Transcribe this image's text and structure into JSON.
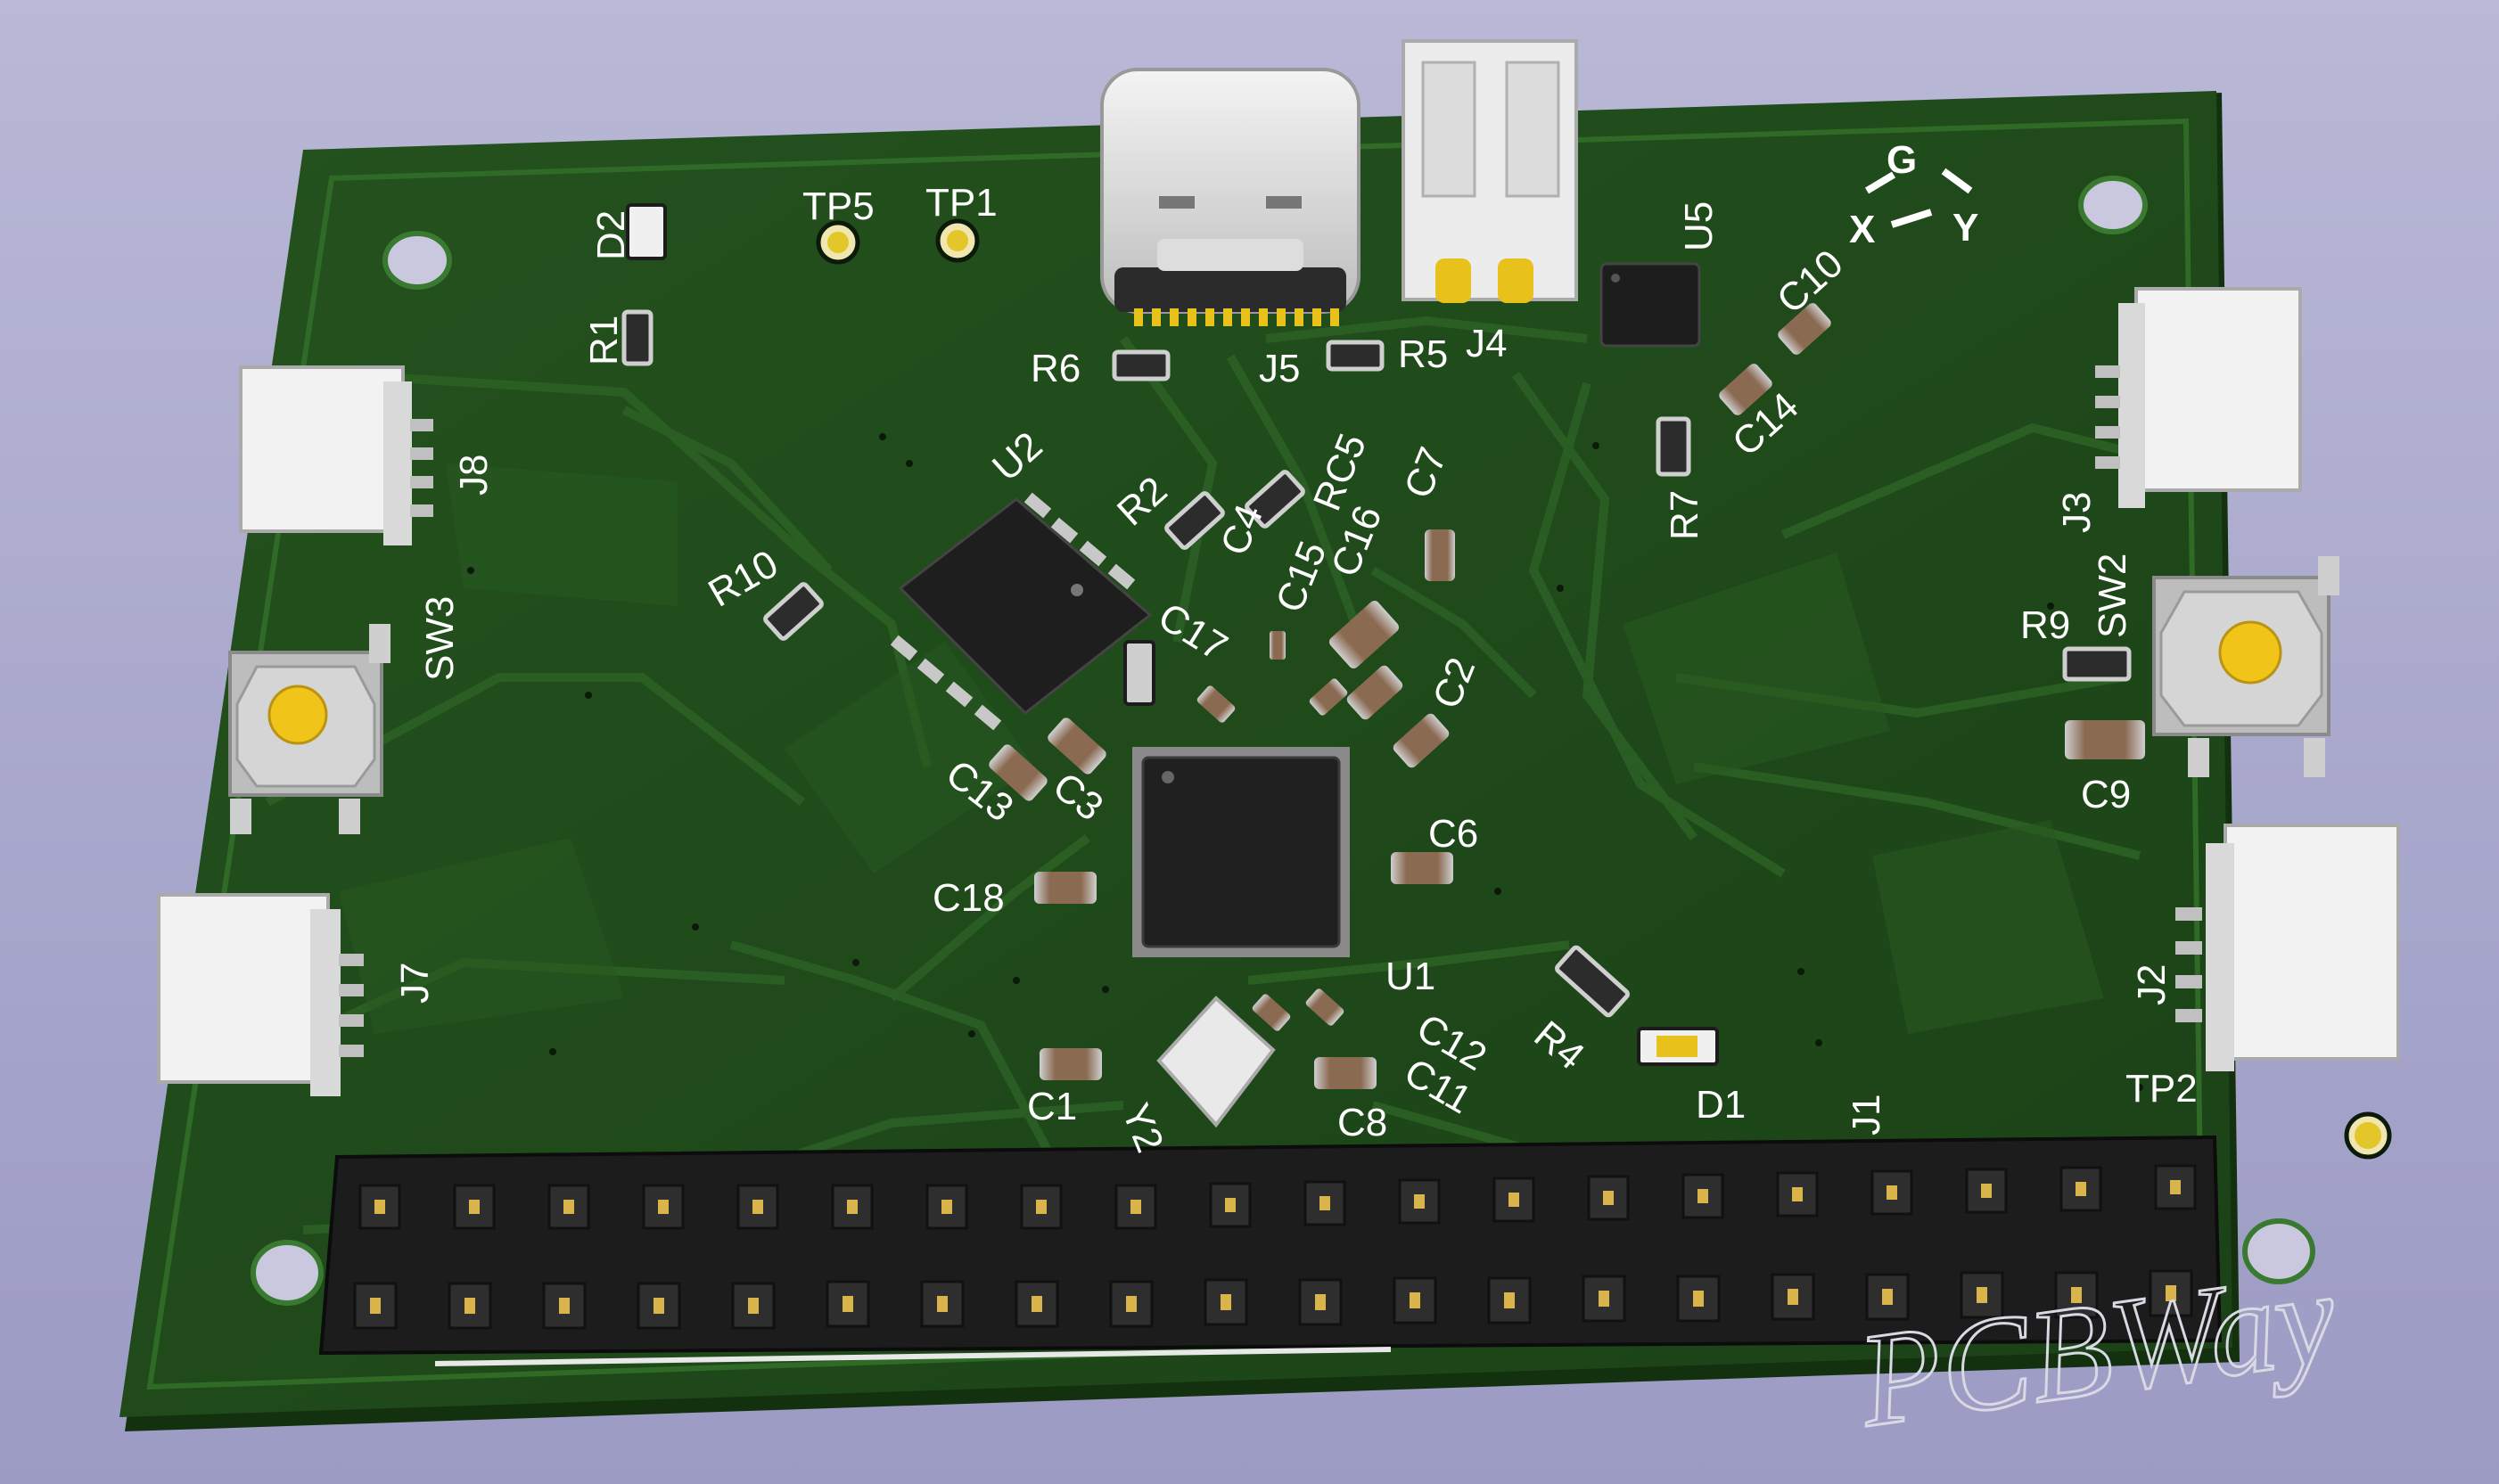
{
  "board": {
    "colors": {
      "solder_mask": "#1f4a1a",
      "copper_pour": "#2b5e23",
      "silkscreen": "#ffffff",
      "pad_gold": "#e8c21a",
      "connector_white": "#f2f2f2",
      "header_black": "#1c1c1c",
      "background": "#a8a7cc"
    },
    "orientation_mark": {
      "g": "G",
      "x": "X",
      "y": "Y"
    },
    "watermark": "PCBWay",
    "labels": {
      "d2": "D2",
      "tp5": "TP5",
      "tp1": "TP1",
      "r1": "R1",
      "r6": "R6",
      "j5": "J5",
      "r5": "R5",
      "j4": "J4",
      "u5": "U5",
      "c10": "C10",
      "c14": "C14",
      "r7": "R7",
      "j8": "J8",
      "u2": "U2",
      "r2": "R2",
      "c4": "C4",
      "rc5": "RC5",
      "c16": "C16",
      "c7": "C7",
      "c15": "C15",
      "r10": "R10",
      "sw3": "SW3",
      "c17": "C17",
      "c2": "C2",
      "c13": "C13",
      "c3": "C3",
      "c6": "C6",
      "c18": "C18",
      "u1": "U1",
      "j3": "J3",
      "r9": "R9",
      "sw2": "SW2",
      "c9": "C9",
      "j7": "J7",
      "r4": "R4",
      "d1": "D1",
      "c1": "C1",
      "y2": "Y2",
      "c12": "C12",
      "c11": "C11",
      "c8": "C8",
      "j1": "J1",
      "j2": "J2",
      "tp2": "TP2"
    }
  }
}
